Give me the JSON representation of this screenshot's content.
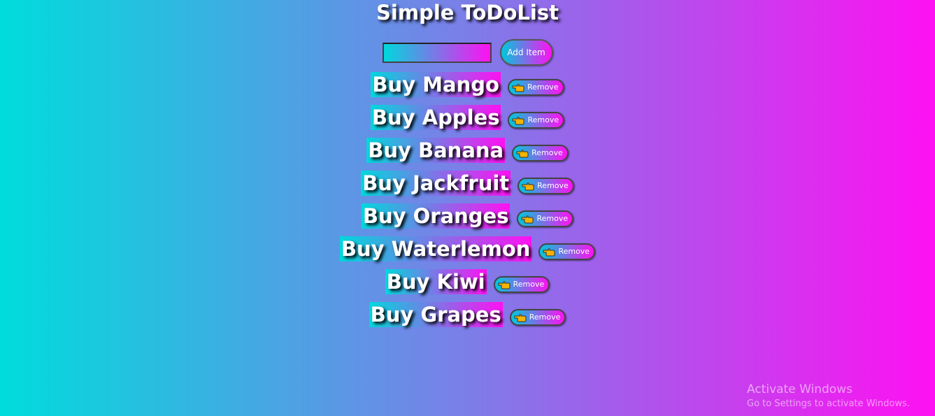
{
  "app": {
    "title": "Simple ToDoList"
  },
  "input": {
    "value": "",
    "placeholder": ""
  },
  "add_button": {
    "label": "Add Item"
  },
  "remove_label": "Remove",
  "remove_icon": "pointing-hand-icon",
  "items": [
    {
      "text": "Buy Mango"
    },
    {
      "text": "Buy Apples"
    },
    {
      "text": "Buy Banana"
    },
    {
      "text": "Buy Jackfruit"
    },
    {
      "text": "Buy Oranges"
    },
    {
      "text": "Buy Waterlemon"
    },
    {
      "text": "Buy Kiwi"
    },
    {
      "text": "Buy Grapes"
    }
  ],
  "watermark": {
    "title": "Activate Windows",
    "subtitle": "Go to Settings to activate Windows."
  },
  "colors": {
    "gradient_start": "#00dcdc",
    "gradient_end": "#ff10f2",
    "text": "#ffffff"
  }
}
